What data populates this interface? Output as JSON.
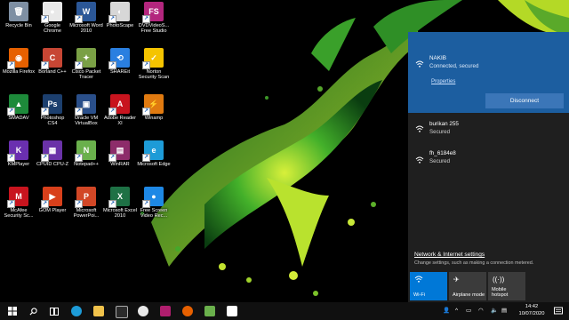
{
  "desktop": {
    "icons": [
      {
        "label": "Recycle Bin",
        "color": "#7e8fa3",
        "glyph": "🗑"
      },
      {
        "label": "Google Chrome",
        "color": "#e9e9e9",
        "glyph": "●"
      },
      {
        "label": "Microsoft Word 2010",
        "color": "#2b5797",
        "glyph": "W"
      },
      {
        "label": "PhotoScape",
        "color": "#d7d7d7",
        "glyph": "◐"
      },
      {
        "label": "DVDVideoS... Free Studio",
        "color": "#b3267e",
        "glyph": "FS"
      },
      {
        "label": "Mozilla Firefox",
        "color": "#e66000",
        "glyph": "◉"
      },
      {
        "label": "Borland C++",
        "color": "#c74634",
        "glyph": "C"
      },
      {
        "label": "Cisco Packet Tracer",
        "color": "#7aa045",
        "glyph": "✦"
      },
      {
        "label": "SHAREit",
        "color": "#2a7fe0",
        "glyph": "⟲"
      },
      {
        "label": "Norton Security Scan",
        "color": "#f5c400",
        "glyph": "✓"
      },
      {
        "label": "SMADAV",
        "color": "#1d8a3a",
        "glyph": "▲"
      },
      {
        "label": "Photoshop CS4",
        "color": "#1c3f6e",
        "glyph": "Ps"
      },
      {
        "label": "Oracle VM VirtualBox",
        "color": "#2a4f8a",
        "glyph": "▣"
      },
      {
        "label": "Adobe Reader XI",
        "color": "#c8141e",
        "glyph": "A"
      },
      {
        "label": "Winamp",
        "color": "#e07a10",
        "glyph": "⚡"
      },
      {
        "label": "KMPlayer",
        "color": "#6a2fb0",
        "glyph": "K"
      },
      {
        "label": "CPUID CPU-Z",
        "color": "#6a32a8",
        "glyph": "▦"
      },
      {
        "label": "Notepad++",
        "color": "#6ab04c",
        "glyph": "N"
      },
      {
        "label": "WinRAR",
        "color": "#8d2c6a",
        "glyph": "▤"
      },
      {
        "label": "Microsoft Edge",
        "color": "#1d9bd7",
        "glyph": "e"
      },
      {
        "label": "McAfee Security Sc...",
        "color": "#c8141e",
        "glyph": "M"
      },
      {
        "label": "GOM Player",
        "color": "#d8401b",
        "glyph": "▶"
      },
      {
        "label": "Microsoft PowerPoi...",
        "color": "#d24726",
        "glyph": "P"
      },
      {
        "label": "Microsoft Excel 2010",
        "color": "#1e7145",
        "glyph": "X"
      },
      {
        "label": "Free Screen Video Rec...",
        "color": "#1e88e5",
        "glyph": "●"
      }
    ]
  },
  "network_flyout": {
    "connected": {
      "name": "NAKIB",
      "status": "Connected, secured",
      "properties_link": "Properties",
      "disconnect_label": "Disconnect"
    },
    "networks": [
      {
        "name": "burikan 255",
        "status": "Secured"
      },
      {
        "name": "fh_6184e8",
        "status": "Secured"
      }
    ],
    "settings_title": "Network & Internet settings",
    "settings_desc": "Change settings, such as making a connection metered.",
    "quick_actions": [
      {
        "label": "Wi-Fi",
        "active": true,
        "icon": "wifi-icon"
      },
      {
        "label": "Airplane mode",
        "active": false,
        "icon": "airplane-icon"
      },
      {
        "label": "Mobile hotspot",
        "active": false,
        "icon": "hotspot-icon"
      }
    ]
  },
  "taskbar": {
    "clock_time": "14:42",
    "clock_date": "10/07/2020",
    "tray_up_arrow": "^",
    "accent": "#0078d7"
  }
}
